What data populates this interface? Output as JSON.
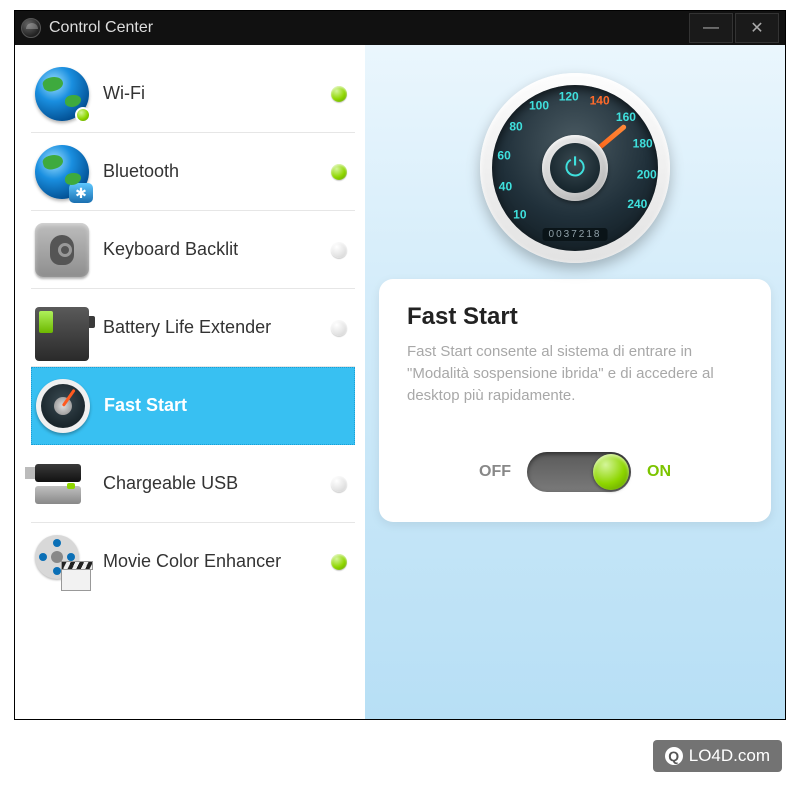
{
  "window": {
    "title": "Control Center"
  },
  "sidebar": {
    "items": [
      {
        "label": "Wi-Fi",
        "status": "on"
      },
      {
        "label": "Bluetooth",
        "status": "on"
      },
      {
        "label": "Keyboard Backlit",
        "status": "off"
      },
      {
        "label": "Battery Life Extender",
        "status": "off"
      },
      {
        "label": "Fast Start",
        "status": "on",
        "selected": true
      },
      {
        "label": "Chargeable USB",
        "status": "off"
      },
      {
        "label": "Movie Color Enhancer",
        "status": "on"
      }
    ]
  },
  "gauge": {
    "ticks": [
      "10",
      "40",
      "60",
      "80",
      "100",
      "120",
      "140",
      "160",
      "180",
      "200",
      "240"
    ],
    "odometer": "0037218"
  },
  "detail": {
    "title": "Fast Start",
    "description": "Fast Start consente al sistema di entrare in \"Modalità sospensione ibrida\" e di accedere al desktop più rapidamente.",
    "toggle": {
      "state": "on",
      "off_label": "OFF",
      "on_label": "ON"
    }
  },
  "watermark": "LO4D.com"
}
